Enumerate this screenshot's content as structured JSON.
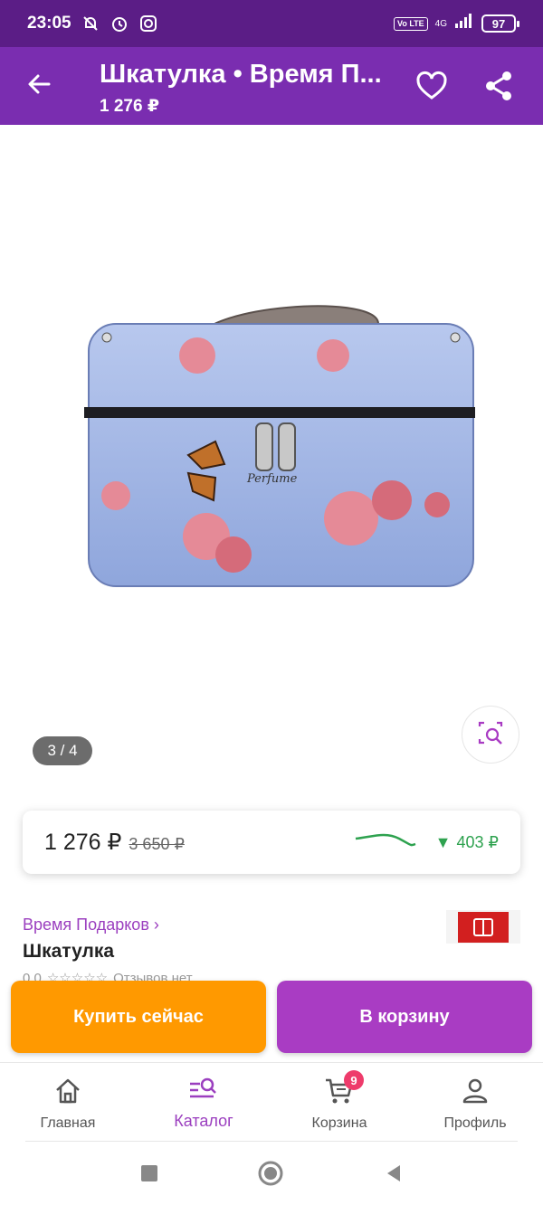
{
  "status_bar": {
    "time": "23:05",
    "network": "4G",
    "volte": "Vo LTE",
    "battery": "97",
    "icons": [
      "muted-bell-icon",
      "alarm-icon",
      "instagram-icon",
      "signal-icon",
      "battery-icon"
    ]
  },
  "header": {
    "title": "Шкатулка • Время П...",
    "price": "1 276 ₽",
    "background": "#7a2db0",
    "icons": [
      "back-arrow-icon",
      "heart-icon",
      "share-icon"
    ]
  },
  "gallery": {
    "counter": "3 / 4",
    "image_icon": "product-photo-cosmetic-case",
    "search_icon": "visual-search-icon"
  },
  "price_card": {
    "price": "1 276 ₽",
    "old_price": "3 650 ₽",
    "drop": "403 ₽",
    "drop_color": "#2ea24f"
  },
  "product": {
    "brand": "Время Подарков ›",
    "name": "Шкатулка",
    "rating": "0.0",
    "reviews": "Отзывов нет"
  },
  "actions": {
    "buy_now": "Купить сейчас",
    "buy_now_color": "#ff9900",
    "add_to_cart": "В корзину",
    "add_to_cart_color": "#a93cc3"
  },
  "bottom_nav": {
    "items": [
      {
        "label": "Главная",
        "icon": "home-icon"
      },
      {
        "label": "Каталог",
        "icon": "catalog-search-icon",
        "active": true
      },
      {
        "label": "Корзина",
        "icon": "cart-icon",
        "badge": "9"
      },
      {
        "label": "Профиль",
        "icon": "profile-icon"
      }
    ],
    "accent": "#9b3fbf"
  },
  "system_nav": {
    "icons": [
      "recents-square-icon",
      "home-circle-icon",
      "back-triangle-icon"
    ]
  }
}
